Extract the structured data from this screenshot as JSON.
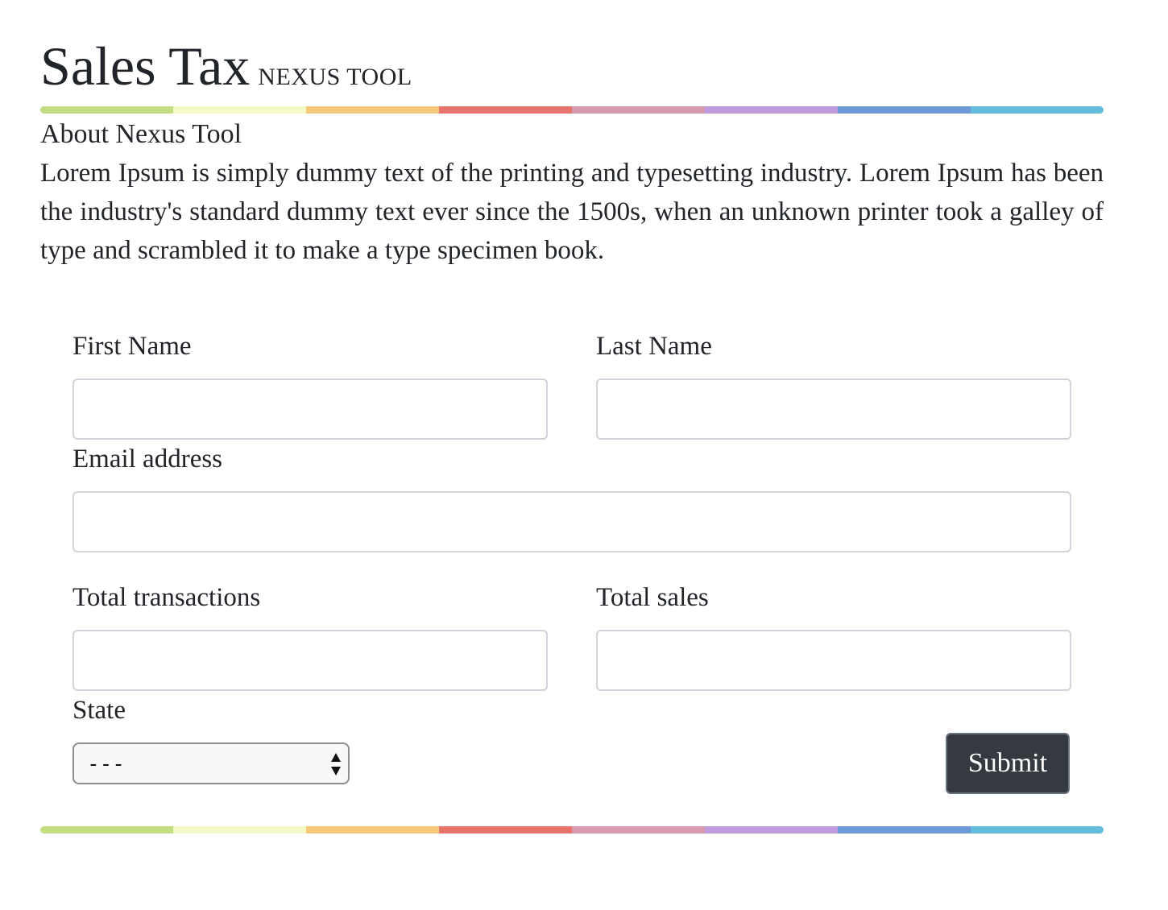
{
  "header": {
    "title": "Sales Tax",
    "subtitle": "NEXUS TOOL"
  },
  "rainbow_colors": [
    "#c3de82",
    "#f5f9c8",
    "#f7c97a",
    "#e8726c",
    "#d79aae",
    "#c09bdb",
    "#6f98d6",
    "#63bcdb"
  ],
  "about": {
    "title": "About Nexus Tool",
    "text": "Lorem Ipsum is simply dummy text of the printing and typesetting industry. Lorem Ipsum has been the industry's standard dummy text ever since the 1500s, when an unknown printer took a galley of type and scrambled it to make a type specimen book."
  },
  "form": {
    "first_name_label": "First Name",
    "first_name_value": "",
    "last_name_label": "Last Name",
    "last_name_value": "",
    "email_label": "Email address",
    "email_value": "",
    "transactions_label": "Total transactions",
    "transactions_value": "",
    "sales_label": "Total sales",
    "sales_value": "",
    "state_label": "State",
    "state_selected": "---",
    "submit_label": "Submit"
  },
  "colors": {
    "text": "#212529",
    "button_bg": "#343a40",
    "input_border": "#ced4da"
  }
}
